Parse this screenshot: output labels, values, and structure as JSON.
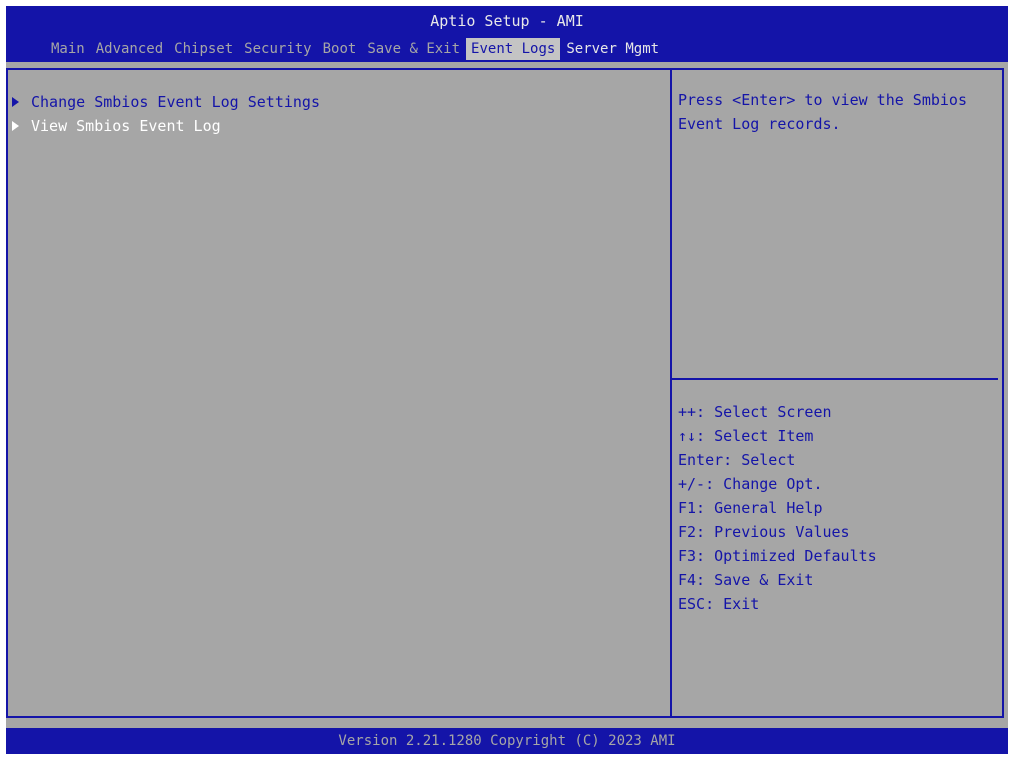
{
  "header": {
    "title": "Aptio Setup - AMI",
    "tabs": [
      "Main",
      "Advanced",
      "Chipset",
      "Security",
      "Boot",
      "Save & Exit",
      "Event Logs",
      "Server Mgmt"
    ],
    "active_tab": "Event Logs"
  },
  "menu": {
    "items": [
      {
        "label": "Change Smbios Event Log Settings",
        "selected": false
      },
      {
        "label": "View Smbios Event Log",
        "selected": true
      }
    ]
  },
  "help": {
    "text": "Press <Enter> to view the Smbios Event Log records."
  },
  "keys": [
    "++: Select Screen",
    "↑↓: Select Item",
    "Enter: Select",
    "+/-: Change Opt.",
    "F1: General Help",
    "F2: Previous Values",
    "F3: Optimized Defaults",
    "F4: Save & Exit",
    "ESC: Exit"
  ],
  "footer": {
    "version": "Version 2.21.1280 Copyright (C) 2023 AMI"
  },
  "colors": {
    "bios_blue": "#1414a8",
    "panel_gray": "#a6a6a6",
    "active_tab_bg": "#c4c4c4",
    "selected_text": "#ffffff"
  }
}
